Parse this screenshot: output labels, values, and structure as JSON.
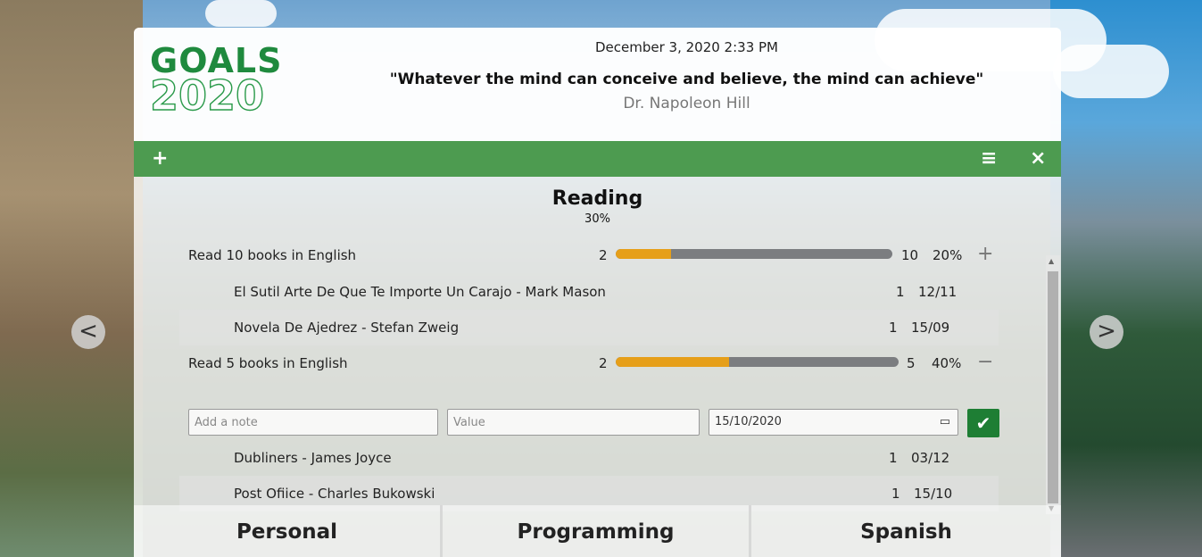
{
  "header": {
    "logo_line1": "GOALS",
    "logo_line2": "2020",
    "datetime": "December 3, 2020 2:33 PM",
    "quote": "\"Whatever the mind can conceive and believe, the mind can achieve\"",
    "author": "Dr. Napoleon Hill"
  },
  "toolbar": {
    "add_icon": "+",
    "menu_icon": "≡",
    "close_icon": "×",
    "color": "#4d9b50"
  },
  "goal": {
    "title": "Reading",
    "percent": "30%"
  },
  "subgoals": [
    {
      "label": "Read 10 books in English",
      "current": "2",
      "target": "10",
      "percent": "20%",
      "fill_fraction": 0.2,
      "action_icon": "+",
      "entries": [
        {
          "title": "El Sutil Arte De Que Te Importe Un Carajo - Mark Mason",
          "value": "1",
          "date": "12/11"
        },
        {
          "title": "Novela De Ajedrez - Stefan Zweig",
          "value": "1",
          "date": "15/09"
        }
      ]
    },
    {
      "label": "Read 5 books in English",
      "current": "2",
      "target": "5",
      "percent": "40%",
      "fill_fraction": 0.4,
      "action_icon": "−",
      "entries": [
        {
          "title": "Dubliners - James Joyce",
          "value": "1",
          "date": "03/12"
        },
        {
          "title": "Post Ofiice - Charles Bukowski",
          "value": "1",
          "date": "15/10"
        }
      ]
    }
  ],
  "form": {
    "note_placeholder": "Add a note",
    "value_placeholder": "Value",
    "date_value": "15/10/2020",
    "submit_icon": "✔"
  },
  "tabs": [
    "Personal",
    "Programming",
    "Spanish"
  ],
  "nav": {
    "prev": "<",
    "next": ">"
  },
  "colors": {
    "progress_fill": "#e69f19",
    "progress_track": "#7b7d80",
    "submit": "#1e7e34"
  }
}
